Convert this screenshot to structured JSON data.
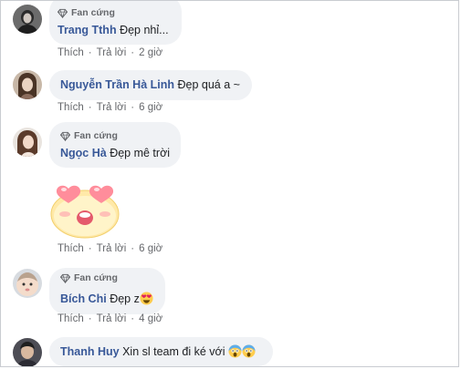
{
  "comments": [
    {
      "badge": "Fan cứng",
      "author": "Trang Tthh",
      "text": "Đẹp nhỉ...",
      "like": "Thích",
      "reply": "Trả lời",
      "time": "2 giờ"
    },
    {
      "badge": "",
      "author": "Nguyễn Trần Hà Linh",
      "text": "Đẹp quá a ~",
      "like": "Thích",
      "reply": "Trả lời",
      "time": "6 giờ"
    },
    {
      "badge": "Fan cứng",
      "author": "Ngọc Hà",
      "text": "Đẹp mê trời",
      "like": "Thích",
      "reply": "Trả lời",
      "time": "6 giờ",
      "sticker": "heart-eyes-sticker"
    },
    {
      "badge": "Fan cứng",
      "author": "Bích Chi",
      "text": "Đẹp z",
      "emoji": "heart-eyes-emoji",
      "like": "Thích",
      "reply": "Trả lời",
      "time": "4 giờ"
    },
    {
      "badge": "",
      "author": "Thanh Huy",
      "text": "Xin sl team đi ké với",
      "emoji": "screaming-face-emoji"
    }
  ],
  "colors": {
    "author": "#385898",
    "bubble": "#f0f2f5",
    "meta": "#65676b"
  }
}
